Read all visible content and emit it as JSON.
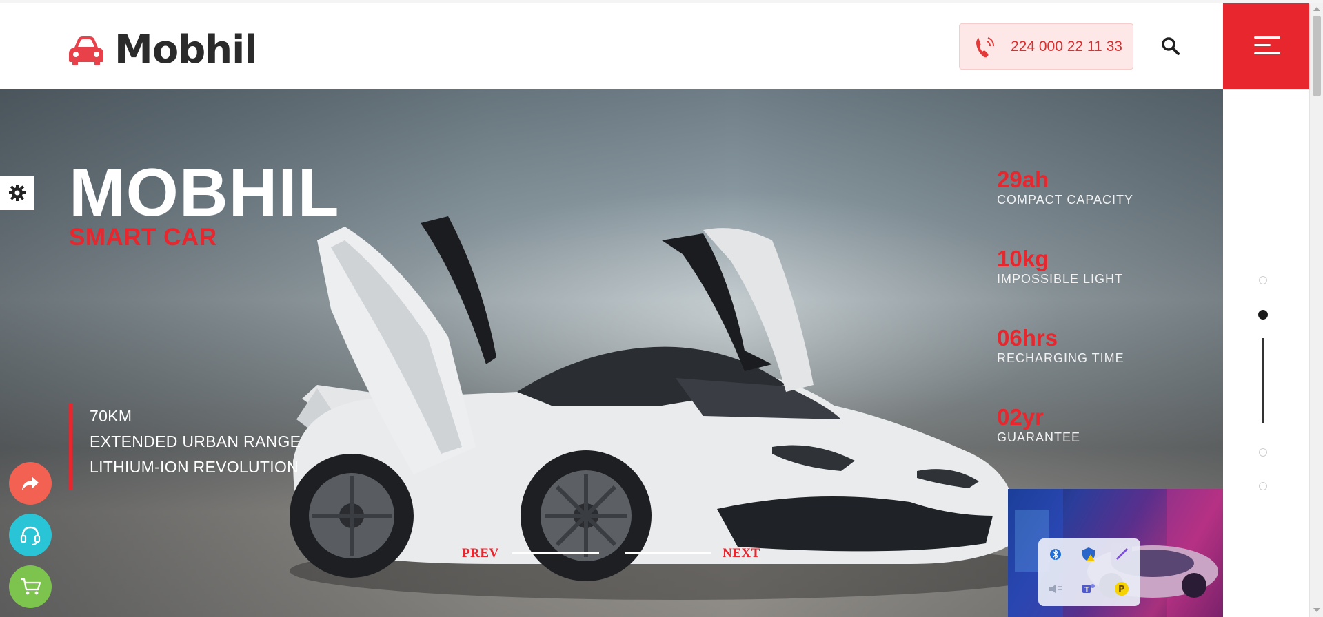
{
  "brand": {
    "name": "Mobhil"
  },
  "header": {
    "phone_number": "224 000 22 11 33"
  },
  "hero": {
    "title": "MOBHIL",
    "subtitle": "SMART CAR",
    "specs": [
      "70KM",
      "EXTENDED URBAN RANGE",
      "LITHIUM-ION REVOLUTION"
    ],
    "stats": [
      {
        "value": "29ah",
        "label": "COMPACT CAPACITY"
      },
      {
        "value": "10kg",
        "label": "IMPOSSIBLE LIGHT"
      },
      {
        "value": "06hrs",
        "label": "RECHARGING TIME"
      },
      {
        "value": "02yr",
        "label": "GUARANTEE"
      }
    ],
    "nav": {
      "prev": "PREV",
      "next": "NEXT"
    }
  },
  "pagination": {
    "count": 4,
    "active_index": 1
  },
  "colors": {
    "accent": "#e8262d",
    "dark": "#2b2b2b",
    "share": "#f26151",
    "support": "#29c4d6",
    "cart": "#7dc44e"
  },
  "icons": {
    "logo": "car-icon",
    "phone": "phone-icon",
    "search": "search-icon",
    "menu": "hamburger-icon",
    "settings": "gear-icon",
    "share": "share-icon",
    "support": "headset-icon",
    "cart": "cart-icon"
  }
}
